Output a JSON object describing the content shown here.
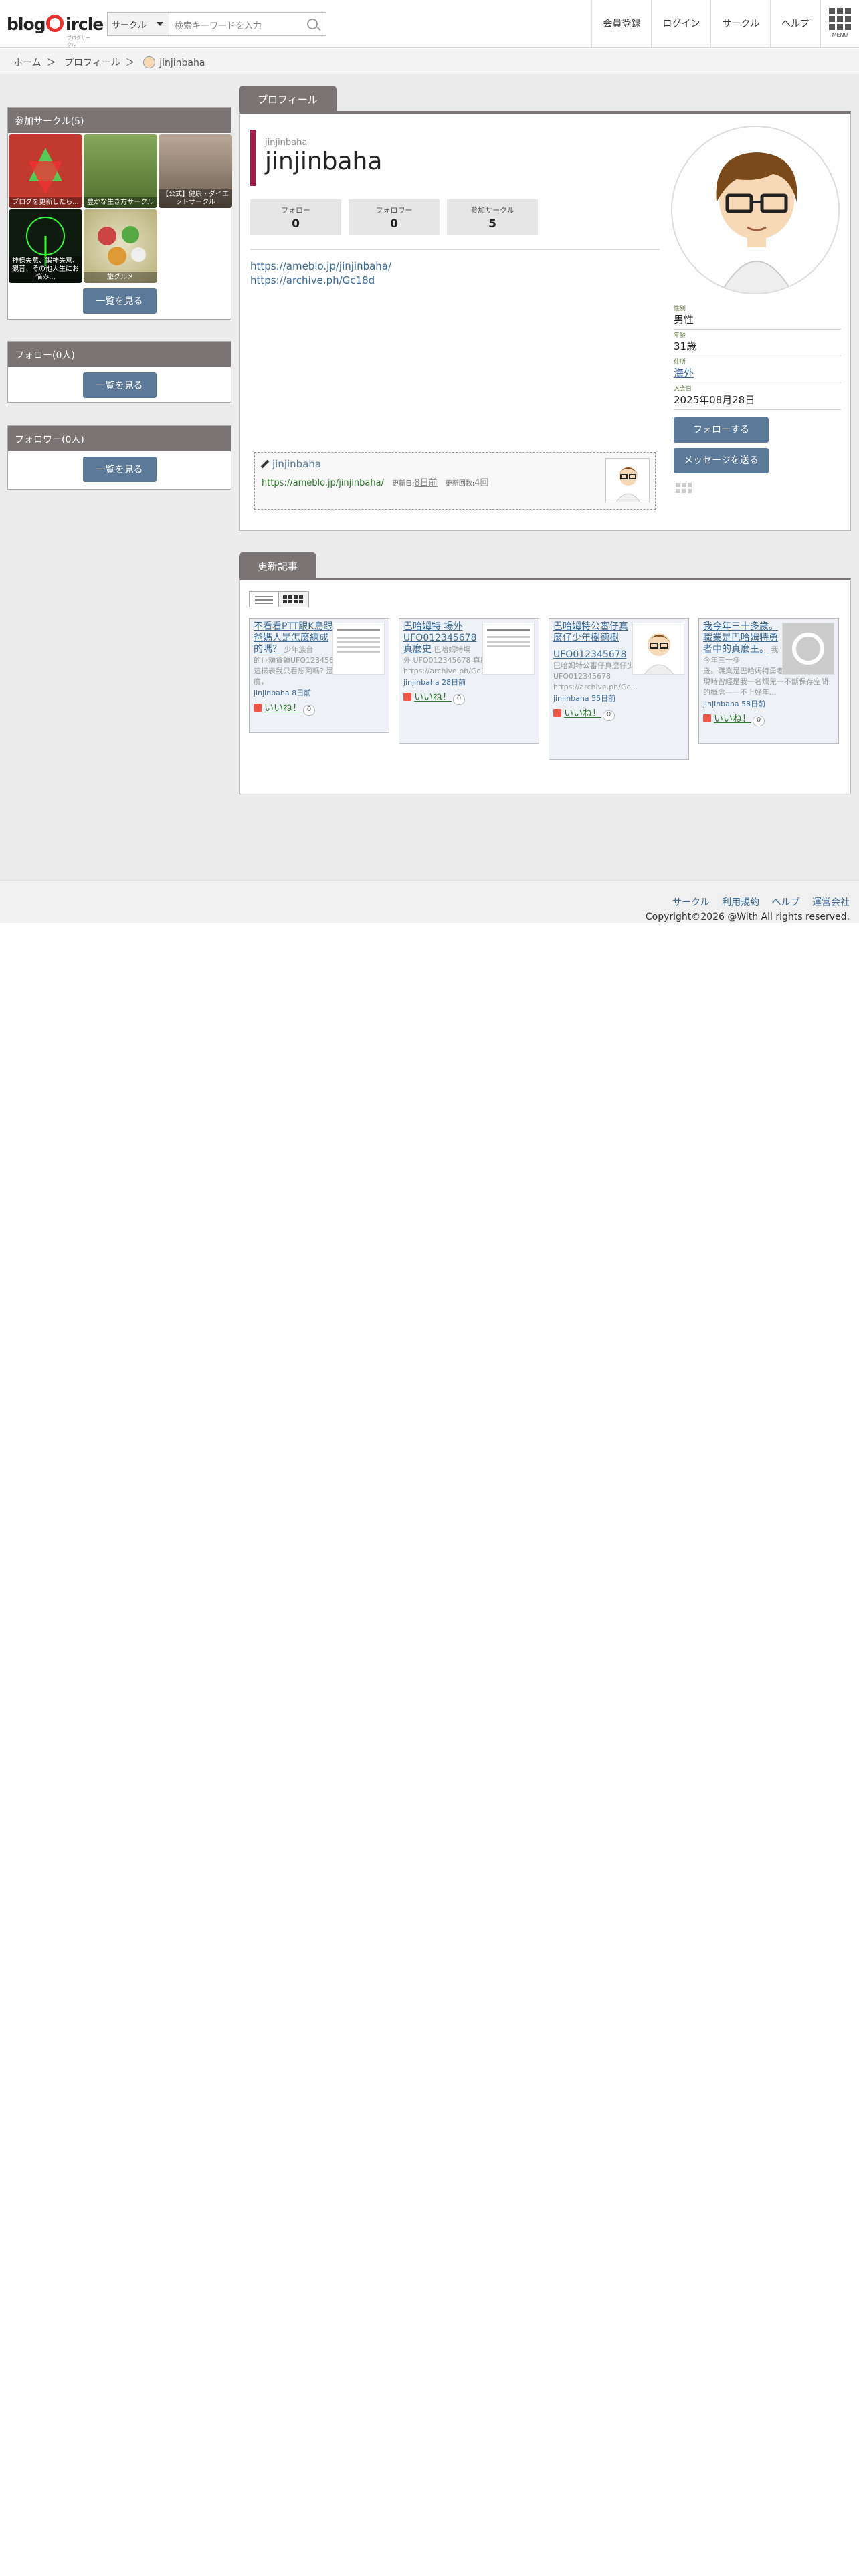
{
  "header": {
    "logo_text": "blogCircle",
    "logo_sub": "ブログサークル",
    "search_scope": "サークル",
    "search_placeholder": "検索キーワードを入力",
    "nav": [
      "会員登録",
      "ログイン",
      "サークル",
      "ヘルプ"
    ],
    "menu_label": "MENU"
  },
  "breadcrumb": [
    "ホーム",
    "プロフィール",
    "jinjinbaha"
  ],
  "sidebar": {
    "circles_title": "参加サークル(5)",
    "circles": [
      {
        "label": "ブログを更新したら...",
        "badge": "",
        "color": "#c23a2f"
      },
      {
        "label": "豊かな生き方サークル",
        "badge": "",
        "color": "#5f8a3f"
      },
      {
        "label": "【公式】健康・ダイエットサークル",
        "badge": "",
        "color": "#8a7a6a"
      },
      {
        "label": "神様失意、鍛神失意、観音、その他人生にお悩み...",
        "badge": "",
        "color": "#1f3a1f"
      },
      {
        "label": "旅グルメ",
        "badge": "",
        "color": "#a9a26a"
      }
    ],
    "see_all": "一覧を見る",
    "follow_title": "フォロー(0人)",
    "follower_title": "フォロワー(0人)"
  },
  "profile": {
    "tab": "プロフィール",
    "name_small": "jinjinbaha",
    "name": "jinjinbaha",
    "stats": [
      {
        "label": "フォロー",
        "value": "0"
      },
      {
        "label": "フォロワー",
        "value": "0"
      },
      {
        "label": "参加サークル",
        "value": "5"
      }
    ],
    "links": [
      "https://ameblo.jp/jinjinbaha/",
      "https://archive.ph/Gc18d"
    ],
    "feed": {
      "name": "jinjinbaha",
      "url": "https://ameblo.jp/jinjinbaha/",
      "updated_label": "更新日:",
      "updated_value": "8日前",
      "count_label": "更新回数:",
      "count_value": "4回"
    },
    "info": [
      {
        "key": "性別",
        "value": "男性"
      },
      {
        "key": "年齢",
        "value": "31歳"
      },
      {
        "key": "住所",
        "value": "海外"
      },
      {
        "key": "入会日",
        "value": "2025年08月28日"
      }
    ],
    "follow_btn": "フォローする",
    "message_btn": "メッセージを送る"
  },
  "updates": {
    "tab": "更新記事",
    "cards": [
      {
        "title": "不看看PTT跟K島跟爸媽人是怎麼練成的嗎？",
        "excerpt_top": "少年族台",
        "excerpt": "的巨額貪領UFO12345678 廢3號: 少看這樣表我只看想阿嗎? 是這些前人很廣，",
        "author": "jinjinbaha",
        "age": "8日前",
        "like": "いいね！",
        "count": "0"
      },
      {
        "title": "巴哈姆特 場外UFO012345678 真麼史",
        "excerpt_top": "巴哈姆特場",
        "excerpt": "外 UFO012345678 真麼史 https://archive.ph/Gc18d...",
        "author": "jinjinbaha",
        "age": "28日前",
        "like": "いいね！",
        "count": "0"
      },
      {
        "title": "巴哈姆特公審仔真麼仔少年樹德樹",
        "excerpt_top": "",
        "title2": "UFO012345678",
        "excerpt": "巴哈姆特公審仔真麼仔少年樹德樹 UFO012345678 https://archive.ph/Gc...",
        "author": "jinjinbaha",
        "age": "55日前",
        "like": "いいね！",
        "count": "0"
      },
      {
        "title": "我今年三十多歲。職業是巴哈姆特勇者中的真麼王。",
        "excerpt_top": "我今年三十多",
        "excerpt": "歲。職業是巴哈姆特勇者中的真 麼王。現時曾經是我一名爛兒一不斷保存空間的概念——不上好年...",
        "author": "jinjinbaha",
        "age": "58日前",
        "like": "いいね！",
        "count": "0"
      }
    ]
  },
  "footer": {
    "links": [
      "サークル",
      "利用規約",
      "ヘルプ",
      "運営会社"
    ],
    "copyright": "Copyright©2026 @With All rights reserved."
  }
}
